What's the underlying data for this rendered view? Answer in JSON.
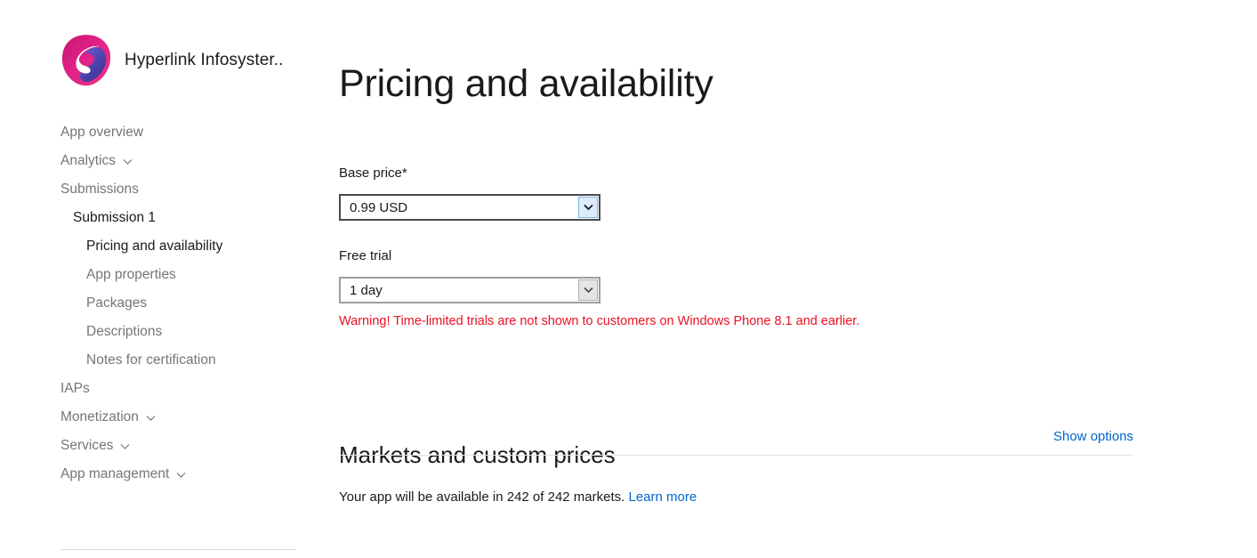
{
  "brand": {
    "name": "Hyperlink Infosyster..",
    "logo_icon": "hyperlink-logo-icon",
    "colors": {
      "outer": "#e0218a",
      "inner": "#4a3fa8",
      "accent": "#d1206f"
    }
  },
  "sidebar": {
    "items": [
      {
        "label": "App overview",
        "level": 0,
        "chevron": false,
        "active": false
      },
      {
        "label": "Analytics",
        "level": 0,
        "chevron": true,
        "active": false
      },
      {
        "label": "Submissions",
        "level": 0,
        "chevron": false,
        "active": false
      },
      {
        "label": "Submission 1",
        "level": 1,
        "chevron": false,
        "active": true
      },
      {
        "label": "Pricing and availability",
        "level": 2,
        "chevron": false,
        "active": true
      },
      {
        "label": "App properties",
        "level": 2,
        "chevron": false,
        "active": false
      },
      {
        "label": "Packages",
        "level": 2,
        "chevron": false,
        "active": false
      },
      {
        "label": "Descriptions",
        "level": 2,
        "chevron": false,
        "active": false
      },
      {
        "label": "Notes for certification",
        "level": 2,
        "chevron": false,
        "active": false
      },
      {
        "label": "IAPs",
        "level": 0,
        "chevron": false,
        "active": false
      },
      {
        "label": "Monetization",
        "level": 0,
        "chevron": true,
        "active": false
      },
      {
        "label": "Services",
        "level": 0,
        "chevron": true,
        "active": false
      },
      {
        "label": "App management",
        "level": 0,
        "chevron": true,
        "active": false
      }
    ],
    "chevron_icon": "chevron-down-icon"
  },
  "main": {
    "page_title": "Pricing and availability",
    "base_price": {
      "label": "Base price*",
      "value": "0.99 USD",
      "arrow_icon": "chevron-down-icon",
      "focused": true
    },
    "free_trial": {
      "label": "Free trial",
      "value": "1 day",
      "arrow_icon": "chevron-down-icon",
      "focused": false
    },
    "trial_warning": "Warning! Time-limited trials are not shown to customers on Windows Phone 8.1 and earlier.",
    "warning_color": "#e81123",
    "markets": {
      "heading": "Markets and custom prices",
      "show_options_label": "Show options",
      "availability_text": "Your app will be available in 242 of 242 markets.",
      "learn_more_label": "Learn more",
      "link_color": "#0066cc"
    }
  }
}
